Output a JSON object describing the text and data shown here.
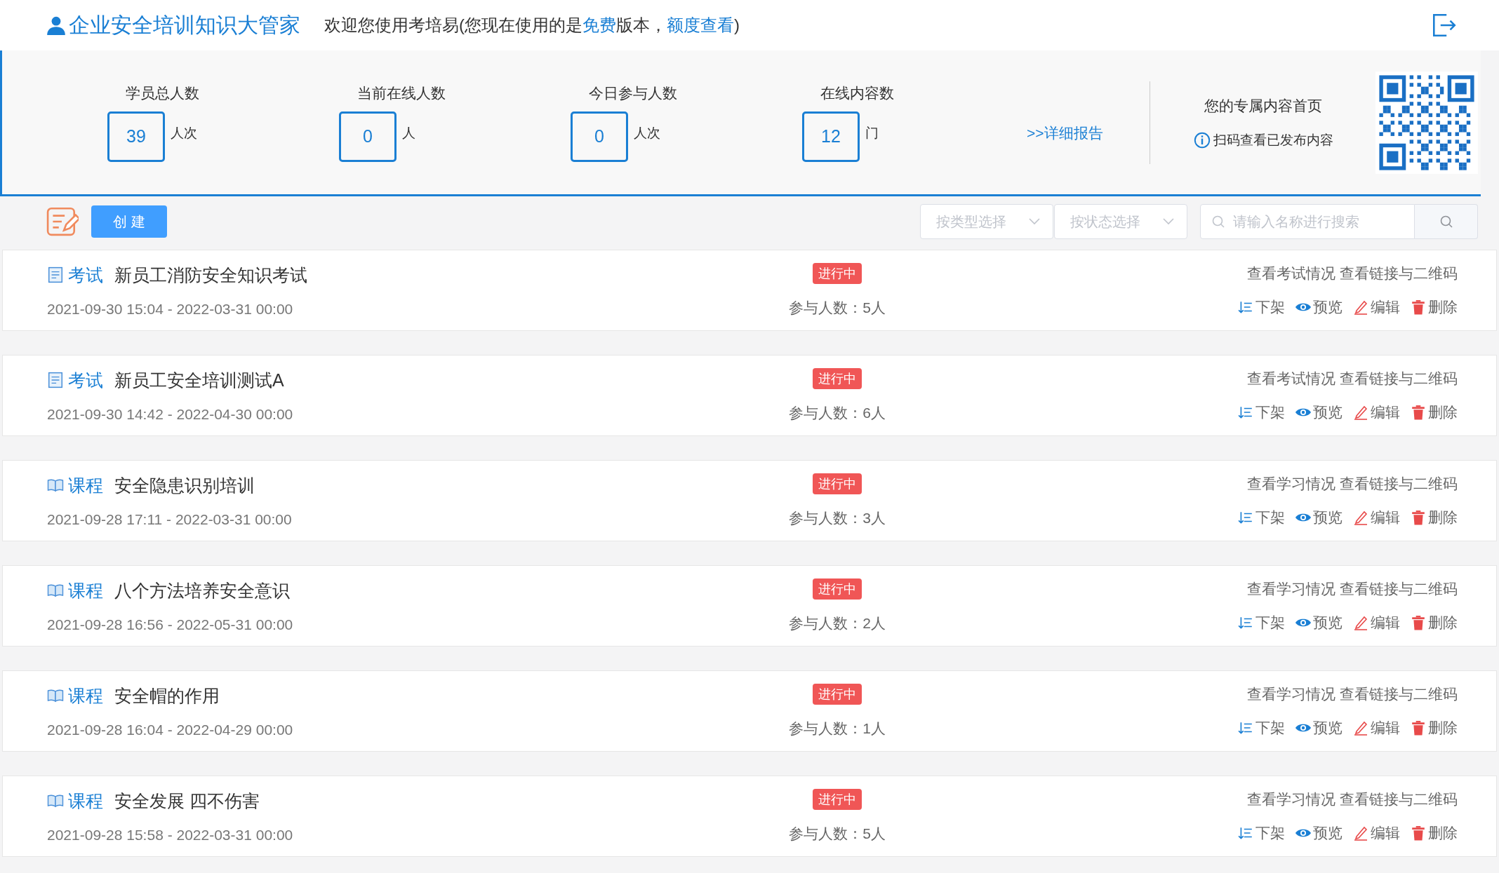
{
  "header": {
    "title": "企业安全培训知识大管家",
    "welcome_parts": [
      {
        "text": "欢迎您使用考培易(您现在使用的是",
        "link": false
      },
      {
        "text": "免费",
        "link": true
      },
      {
        "text": "版本，",
        "link": false
      },
      {
        "text": "额度查看",
        "link": true
      },
      {
        "text": ")",
        "link": false
      }
    ]
  },
  "stats": [
    {
      "label": "学员总人数",
      "value": "39",
      "unit": "人次"
    },
    {
      "label": "当前在线人数",
      "value": "0",
      "unit": "人"
    },
    {
      "label": "今日参与人数",
      "value": "0",
      "unit": "人次"
    },
    {
      "label": "在线内容数",
      "value": "12",
      "unit": "门"
    }
  ],
  "report_link": ">>详细报告",
  "homepage": {
    "title": "您的专属内容首页",
    "hint": "扫码查看已发布内容"
  },
  "toolbar": {
    "create_button": "创 建",
    "type_select": {
      "placeholder": "按类型选择"
    },
    "status_select": {
      "placeholder": "按状态选择"
    },
    "search": {
      "placeholder": "请输入名称进行搜索"
    }
  },
  "items": [
    {
      "kind": "exam",
      "type": "考试",
      "name": "新员工消防安全知识考试",
      "period": "2021-09-30 15:04 - 2022-03-31 00:00",
      "status": "进行中",
      "participants": "参与人数：5人",
      "view_link": "查看考试情况",
      "qr_link": "查看链接与二维码",
      "actions": [
        "下架",
        "预览",
        "编辑",
        "删除"
      ]
    },
    {
      "kind": "exam",
      "type": "考试",
      "name": "新员工安全培训测试A",
      "period": "2021-09-30 14:42 - 2022-04-30 00:00",
      "status": "进行中",
      "participants": "参与人数：6人",
      "view_link": "查看考试情况",
      "qr_link": "查看链接与二维码",
      "actions": [
        "下架",
        "预览",
        "编辑",
        "删除"
      ]
    },
    {
      "kind": "course",
      "type": "课程",
      "name": "安全隐患识别培训",
      "period": "2021-09-28 17:11 - 2022-03-31 00:00",
      "status": "进行中",
      "participants": "参与人数：3人",
      "view_link": "查看学习情况",
      "qr_link": "查看链接与二维码",
      "actions": [
        "下架",
        "预览",
        "编辑",
        "删除"
      ]
    },
    {
      "kind": "course",
      "type": "课程",
      "name": "八个方法培养安全意识",
      "period": "2021-09-28 16:56 - 2022-05-31 00:00",
      "status": "进行中",
      "participants": "参与人数：2人",
      "view_link": "查看学习情况",
      "qr_link": "查看链接与二维码",
      "actions": [
        "下架",
        "预览",
        "编辑",
        "删除"
      ]
    },
    {
      "kind": "course",
      "type": "课程",
      "name": "安全帽的作用",
      "period": "2021-09-28 16:04 - 2022-04-29 00:00",
      "status": "进行中",
      "participants": "参与人数：1人",
      "view_link": "查看学习情况",
      "qr_link": "查看链接与二维码",
      "actions": [
        "下架",
        "预览",
        "编辑",
        "删除"
      ]
    },
    {
      "kind": "course",
      "type": "课程",
      "name": "安全发展 四不伤害",
      "period": "2021-09-28 15:58 - 2022-03-31 00:00",
      "status": "进行中",
      "participants": "参与人数：5人",
      "view_link": "查看学习情况",
      "qr_link": "查看链接与二维码",
      "actions": [
        "下架",
        "预览",
        "编辑",
        "删除"
      ]
    }
  ]
}
